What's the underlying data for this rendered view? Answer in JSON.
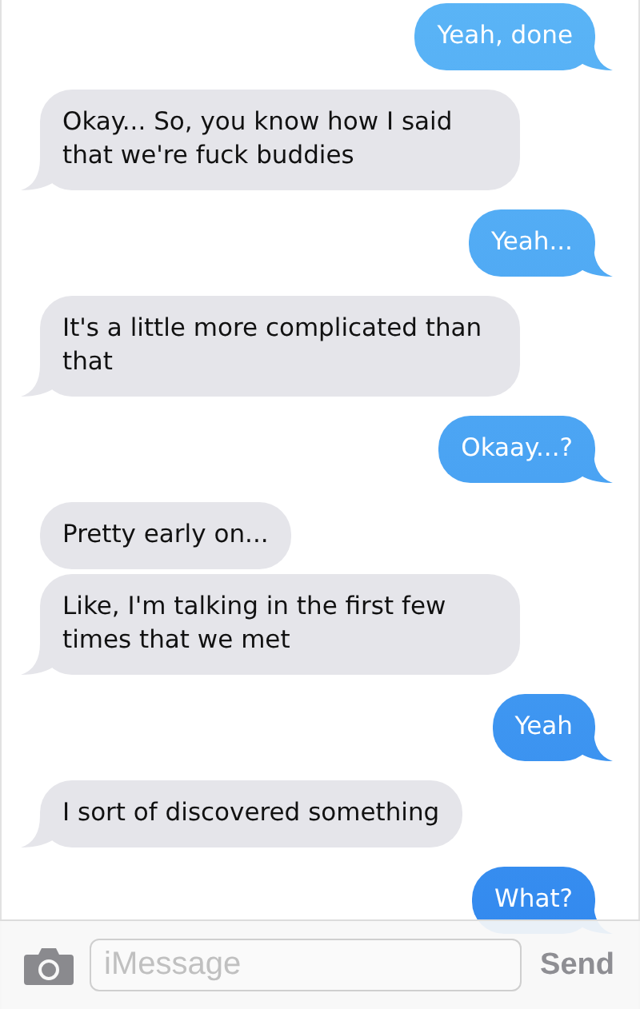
{
  "messages": [
    {
      "kind": "sent",
      "text": "Yeah, done",
      "tail": true
    },
    {
      "kind": "received",
      "text": "Okay... So, you know how I said that we're fuck buddies",
      "tail": true
    },
    {
      "kind": "sent",
      "text": "Yeah...",
      "tail": true
    },
    {
      "kind": "received",
      "text": "It's a little more complicated than that",
      "tail": true
    },
    {
      "kind": "sent",
      "text": "Okaay...?",
      "tail": true
    },
    {
      "kind": "received",
      "text": "Pretty early on...",
      "tail": false
    },
    {
      "kind": "received",
      "text": "Like, I'm talking in the first few times that we met",
      "tail": true
    },
    {
      "kind": "sent",
      "text": "Yeah",
      "tail": true
    },
    {
      "kind": "received",
      "text": "I sort of discovered something",
      "tail": true
    },
    {
      "kind": "sent",
      "text": "What?",
      "tail": true
    }
  ],
  "composer": {
    "placeholder": "iMessage",
    "send_label": "Send"
  }
}
